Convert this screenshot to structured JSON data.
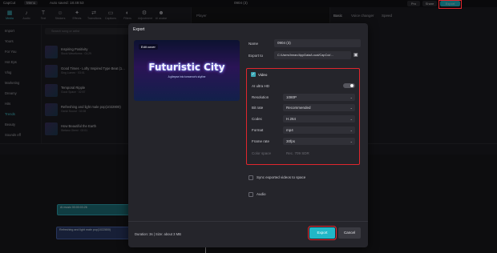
{
  "app": {
    "name": "CapCut",
    "menu": "Menu",
    "autosave": "Auto saved: 18:49:53",
    "project_title": "0904 (3)",
    "top_buttons": {
      "pro": "Pro",
      "share": "Share",
      "export": "Export"
    }
  },
  "toolbar": {
    "items": [
      {
        "icon": "media-icon",
        "label": "Media"
      },
      {
        "icon": "audio-icon",
        "label": "Audio"
      },
      {
        "icon": "text-icon",
        "label": "Text"
      },
      {
        "icon": "stickers-icon",
        "label": "Stickers"
      },
      {
        "icon": "effects-icon",
        "label": "Effects"
      },
      {
        "icon": "transitions-icon",
        "label": "Transitions"
      },
      {
        "icon": "captions-icon",
        "label": "Captions"
      },
      {
        "icon": "filters-icon",
        "label": "Filters"
      },
      {
        "icon": "adjustment-icon",
        "label": "Adjustment"
      },
      {
        "icon": "ai-avatar-icon",
        "label": "AI avatar"
      }
    ]
  },
  "sidenav": [
    "Import",
    "Yours",
    "For You",
    "Hot Eps",
    "Vlog",
    "Marketing",
    "Dreamy",
    "Hits",
    "Trends",
    "Beauty",
    "Sounds eff"
  ],
  "media": {
    "search_placeholder": "Search song or artist",
    "items": [
      {
        "title": "Inspiring Positivity",
        "sub": "Stock Waveforms · 01:29"
      },
      {
        "title": "Good Times - Lofty Inspired Type Beat (1...",
        "sub": "Sing Lumen · 03:01"
      },
      {
        "title": "Temporal Ripple",
        "sub": "Good Space · 02:57"
      },
      {
        "title": "Refreshing and light male pop(1022800)",
        "sub": "Genki Sound · 02:08"
      },
      {
        "title": "How Beautiful the Earth",
        "sub": "Stefano Olemi · 02:01"
      }
    ]
  },
  "player": {
    "title": "Player"
  },
  "rpanel": {
    "tabs": [
      "Basic",
      "Voice changer",
      "Speed"
    ]
  },
  "timeline": {
    "clip1": "AI music  00:00:03:26",
    "clip2": "Refreshing and light male pop(1022800)"
  },
  "dialog": {
    "title": "Export",
    "cover_edit": "Edit cover",
    "cover_title": "Futuristic City",
    "cover_sub": "A glimpse into tomorrow's skyline",
    "name_label": "Name",
    "name_value": "0904 (3)",
    "export_to_label": "Export to",
    "export_to_value": "C:/Users/Imran/AppData/Local/CapCut/...",
    "video_label": "Video",
    "ai_ultra_hd_label": "AI ultra HD",
    "resolution_label": "Resolution",
    "resolution_value": "1080P",
    "bitrate_label": "Bit rate",
    "bitrate_value": "Recommended",
    "codec_label": "Codec",
    "codec_value": "H.264",
    "format_label": "Format",
    "format_value": "mp4",
    "framerate_label": "Frame rate",
    "framerate_value": "30fps",
    "color_space_label": "Color space",
    "color_space_value": "Rec. 709 SDR",
    "sync_label": "Sync exported videos to space",
    "audio_label": "Audio",
    "footer_info": "Duration: 3s | Size: about 3 MB",
    "export_button": "Export",
    "cancel_button": "Cancel"
  }
}
